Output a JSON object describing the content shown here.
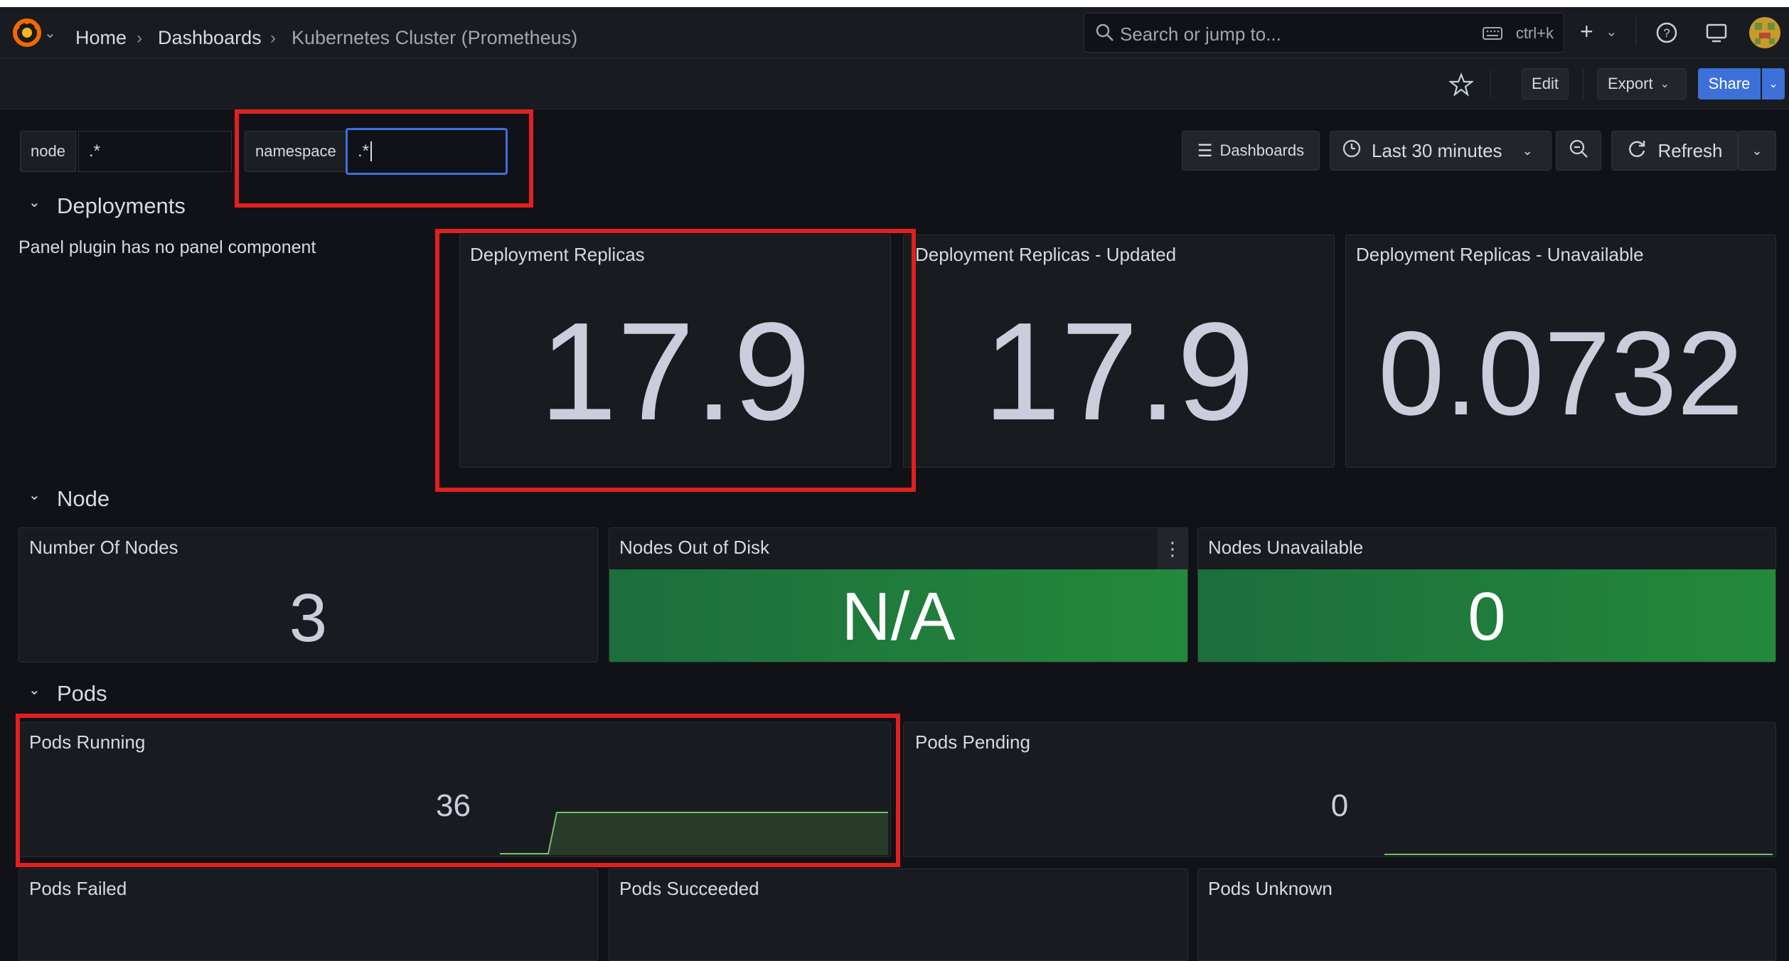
{
  "nav": {
    "breadcrumbs": [
      "Home",
      "Dashboards",
      "Kubernetes Cluster (Prometheus)"
    ],
    "search_placeholder": "Search or jump to...",
    "search_shortcut": "ctrl+k",
    "icons": [
      "grafana-logo-icon",
      "chevron-down-icon",
      "search-icon",
      "keyboard-icon",
      "plus-icon",
      "help-icon",
      "news-icon",
      "avatar"
    ]
  },
  "toolbar": {
    "edit_label": "Edit",
    "export_label": "Export",
    "share_label": "Share"
  },
  "variables": [
    {
      "label": "node",
      "value": ".*"
    },
    {
      "label": "namespace",
      "value": ".*"
    }
  ],
  "controls": {
    "dashboards_label": "Dashboards",
    "time_range": "Last 30 minutes",
    "refresh_label": "Refresh"
  },
  "rows": {
    "deployments": {
      "title": "Deployments",
      "plugin_message": "Panel plugin has no panel component",
      "panels": [
        {
          "title": "Deployment Replicas",
          "value": "17.9"
        },
        {
          "title": "Deployment Replicas - Updated",
          "value": "17.9"
        },
        {
          "title": "Deployment Replicas - Unavailable",
          "value": "0.0732"
        }
      ]
    },
    "node": {
      "title": "Node",
      "panels": [
        {
          "title": "Number Of Nodes",
          "value": "3"
        },
        {
          "title": "Nodes Out of Disk",
          "value": "N/A"
        },
        {
          "title": "Nodes Unavailable",
          "value": "0"
        }
      ]
    },
    "pods": {
      "title": "Pods",
      "panels": [
        {
          "title": "Pods Running",
          "value": "36"
        },
        {
          "title": "Pods Pending",
          "value": "0"
        },
        {
          "title": "Pods Failed",
          "value": ""
        },
        {
          "title": "Pods Succeeded",
          "value": ""
        },
        {
          "title": "Pods Unknown",
          "value": ""
        }
      ]
    }
  },
  "colors": {
    "background": "#111217",
    "panel": "#181b1f",
    "accent": "#3d71d9",
    "ok_green": "#23893b",
    "highlight": "#e02020",
    "sparkline": "#73bf69"
  }
}
